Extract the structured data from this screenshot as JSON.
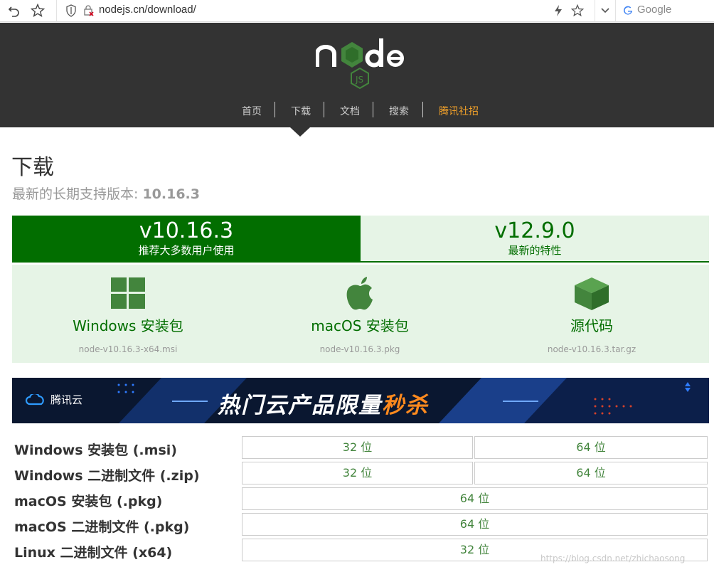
{
  "browser": {
    "url": "nodejs.cn/download/",
    "search_placeholder": "Google",
    "icons": [
      "back-icon",
      "bookmark-star-icon",
      "shield-icon",
      "insecure-icon",
      "lightning-icon",
      "star-icon",
      "chevron-down-icon",
      "google-icon"
    ]
  },
  "header": {
    "nav": [
      {
        "label": "首页"
      },
      {
        "label": "下载"
      },
      {
        "label": "文档"
      },
      {
        "label": "搜索"
      },
      {
        "label": "腾讯社招"
      }
    ]
  },
  "main": {
    "title": "下载",
    "lts_prefix": "最新的长期支持版本: ",
    "lts_version": "10.16.3",
    "tabs": [
      {
        "version": "v10.16.3",
        "desc": "推荐大多数用户使用"
      },
      {
        "version": "v12.9.0",
        "desc": "最新的特性"
      }
    ],
    "downloads": [
      {
        "label": "Windows 安装包",
        "file": "node-v10.16.3-x64.msi",
        "icon": "windows-icon"
      },
      {
        "label": "macOS 安装包",
        "file": "node-v10.16.3.pkg",
        "icon": "apple-icon"
      },
      {
        "label": "源代码",
        "file": "node-v10.16.3.tar.gz",
        "icon": "cube-icon"
      }
    ]
  },
  "banner": {
    "brand": "腾讯云",
    "slogan_main": "热门云产品限量",
    "slogan_highlight": "秒杀"
  },
  "table": {
    "rows": [
      {
        "label": "Windows 安装包 (.msi)",
        "cells": [
          "32 位",
          "64 位"
        ]
      },
      {
        "label": "Windows 二进制文件 (.zip)",
        "cells": [
          "32 位",
          "64 位"
        ]
      },
      {
        "label": "macOS 安装包 (.pkg)",
        "cells": [
          "64 位"
        ]
      },
      {
        "label": "macOS 二进制文件 (.pkg)",
        "cells": [
          "64 位"
        ]
      },
      {
        "label": "Linux 二进制文件 (x64)",
        "cells": [
          "32 位"
        ]
      }
    ]
  },
  "watermark": "https://blog.csdn.net/zhichaosong",
  "colors": {
    "header_bg": "#333333",
    "brand_green": "#026e00",
    "light_green": "#e6f4e6",
    "cell_text": "#43853d",
    "accent_orange": "#f0a02a"
  }
}
